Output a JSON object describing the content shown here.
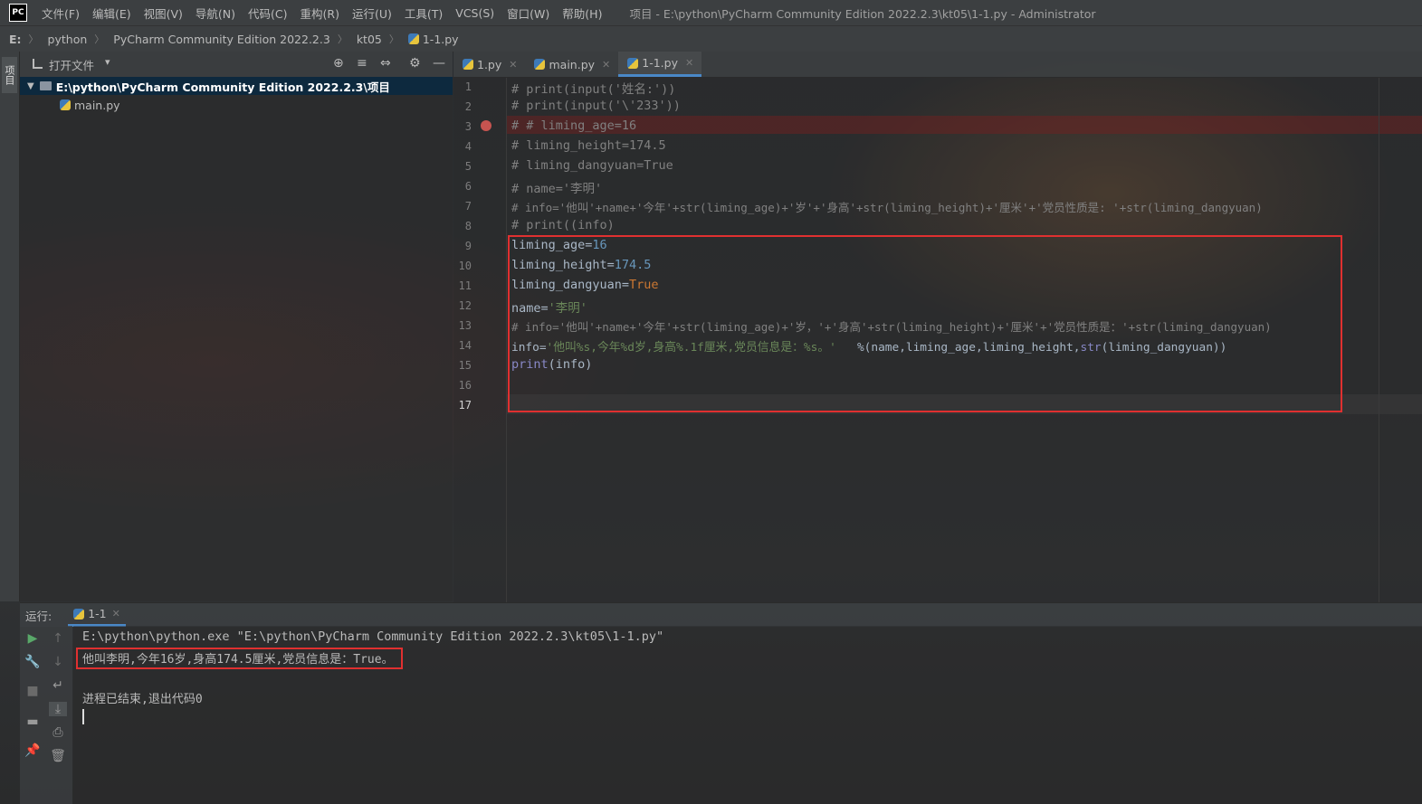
{
  "app": {
    "logo": "PC",
    "window_title": "项目 - E:\\python\\PyCharm Community Edition 2022.2.3\\kt05\\1-1.py - Administrator"
  },
  "menu": [
    "文件(F)",
    "编辑(E)",
    "视图(V)",
    "导航(N)",
    "代码(C)",
    "重构(R)",
    "运行(U)",
    "工具(T)",
    "VCS(S)",
    "窗口(W)",
    "帮助(H)"
  ],
  "breadcrumb": [
    "E:",
    "python",
    "PyCharm Community Edition 2022.2.3",
    "kt05",
    "1-1.py"
  ],
  "left_strip": {
    "project_tab": "项目"
  },
  "project": {
    "title": "打开文件",
    "root": "E:\\python\\PyCharm Community Edition 2022.2.3\\项目",
    "items": [
      "main.py"
    ]
  },
  "tabs": [
    {
      "label": "1.py",
      "active": false
    },
    {
      "label": "main.py",
      "active": false
    },
    {
      "label": "1-1.py",
      "active": true
    }
  ],
  "editor": {
    "line_numbers": [
      "1",
      "2",
      "3",
      "4",
      "5",
      "6",
      "7",
      "8",
      "9",
      "10",
      "11",
      "12",
      "13",
      "14",
      "15",
      "16",
      "17"
    ],
    "lines": [
      "# print(input('姓名:'))",
      "# print(input('\\'233'))",
      "# # liming_age=16",
      "# liming_height=174.5",
      "# liming_dangyuan=True",
      "# name='李明'",
      "# info='他叫'+name+'今年'+str(liming_age)+'岁'+'身高'+str(liming_height)+'厘米'+'党员性质是: '+str(liming_dangyuan)",
      "# print((info)",
      "liming_age=16",
      "liming_height=174.5",
      "liming_dangyuan=True",
      "name='李明'",
      "# info='他叫'+name+'今年'+str(liming_age)+'岁，'+'身高'+str(liming_height)+'厘米'+'党员性质是：'+str(liming_dangyuan)",
      "info='他叫%s,今年%d岁,身高%.1f厘米,党员信息是：%s。'   %(name,liming_age,liming_height,str(liming_dangyuan))",
      "print(info)",
      "",
      ""
    ],
    "breakpoint_line": 3
  },
  "run": {
    "label": "运行:",
    "tab": "1-1",
    "console": [
      "E:\\python\\python.exe \"E:\\python\\PyCharm Community Edition 2022.2.3\\kt05\\1-1.py\"",
      "他叫李明,今年16岁,身高174.5厘米,党员信息是：True。",
      "",
      "进程已结束,退出代码0"
    ]
  },
  "colors": {
    "accent": "#4a88c7",
    "highlight_red": "#e03030",
    "breakpoint": "#c75450"
  }
}
